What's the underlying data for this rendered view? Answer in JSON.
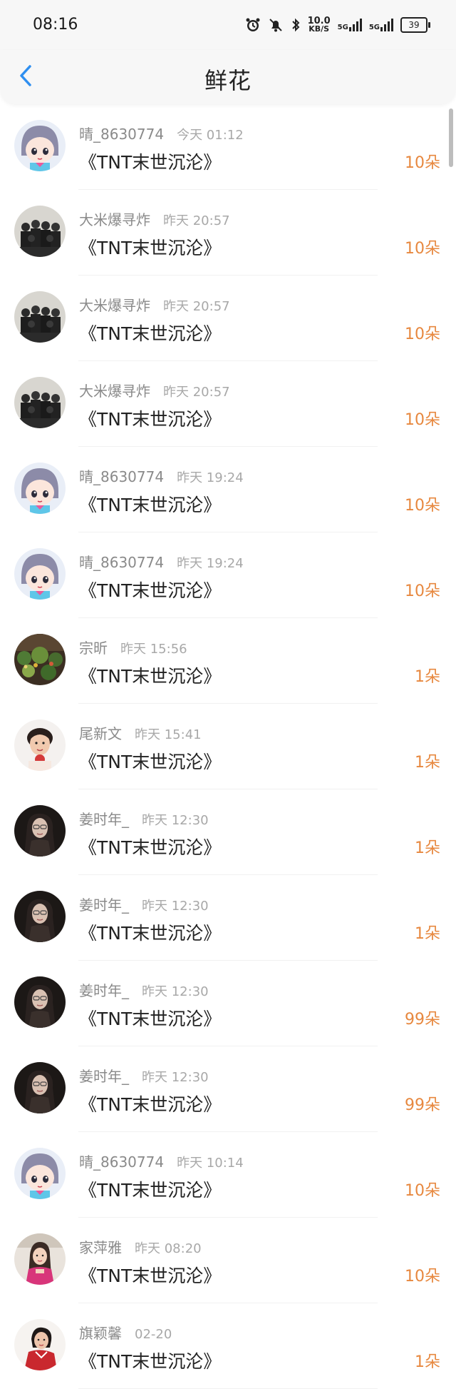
{
  "status_bar": {
    "time": "08:16",
    "net_speed_value": "10.0",
    "net_speed_unit": "KB/S",
    "signal1_label": "5G",
    "signal2_label": "5G",
    "battery": "39"
  },
  "header": {
    "title": "鲜花",
    "back_icon": "chevron-left-icon"
  },
  "colors": {
    "accent": "#2f8ff0",
    "count": "#e7883f",
    "meta": "#8a8a8a"
  },
  "rows": [
    {
      "user": "晴_8630774",
      "time": "今天 01:12",
      "work": "《TNT末世沉沦》",
      "count": "10朵",
      "avatar": "anime"
    },
    {
      "user": "大米爆寻炸",
      "time": "昨天 20:57",
      "work": "《TNT末世沉沦》",
      "count": "10朵",
      "avatar": "group"
    },
    {
      "user": "大米爆寻炸",
      "time": "昨天 20:57",
      "work": "《TNT末世沉沦》",
      "count": "10朵",
      "avatar": "group"
    },
    {
      "user": "大米爆寻炸",
      "time": "昨天 20:57",
      "work": "《TNT末世沉沦》",
      "count": "10朵",
      "avatar": "group"
    },
    {
      "user": "晴_8630774",
      "time": "昨天 19:24",
      "work": "《TNT末世沉沦》",
      "count": "10朵",
      "avatar": "anime"
    },
    {
      "user": "晴_8630774",
      "time": "昨天 19:24",
      "work": "《TNT末世沉沦》",
      "count": "10朵",
      "avatar": "anime"
    },
    {
      "user": "宗昕",
      "time": "昨天 15:56",
      "work": "《TNT末世沉沦》",
      "count": "1朵",
      "avatar": "garden"
    },
    {
      "user": "尾新文",
      "time": "昨天 15:41",
      "work": "《TNT末世沉沦》",
      "count": "1朵",
      "avatar": "woman"
    },
    {
      "user": "姜时年_",
      "time": "昨天 12:30",
      "work": "《TNT末世沉沦》",
      "count": "1朵",
      "avatar": "dark"
    },
    {
      "user": "姜时年_",
      "time": "昨天 12:30",
      "work": "《TNT末世沉沦》",
      "count": "1朵",
      "avatar": "dark"
    },
    {
      "user": "姜时年_",
      "time": "昨天 12:30",
      "work": "《TNT末世沉沦》",
      "count": "99朵",
      "avatar": "dark"
    },
    {
      "user": "姜时年_",
      "time": "昨天 12:30",
      "work": "《TNT末世沉沦》",
      "count": "99朵",
      "avatar": "dark"
    },
    {
      "user": "晴_8630774",
      "time": "昨天 10:14",
      "work": "《TNT末世沉沦》",
      "count": "10朵",
      "avatar": "anime"
    },
    {
      "user": "家萍雅",
      "time": "昨天 08:20",
      "work": "《TNT末世沉沦》",
      "count": "10朵",
      "avatar": "girl"
    },
    {
      "user": "旗颖馨",
      "time": "02-20",
      "work": "《TNT末世沉沦》",
      "count": "1朵",
      "avatar": "portrait"
    }
  ]
}
